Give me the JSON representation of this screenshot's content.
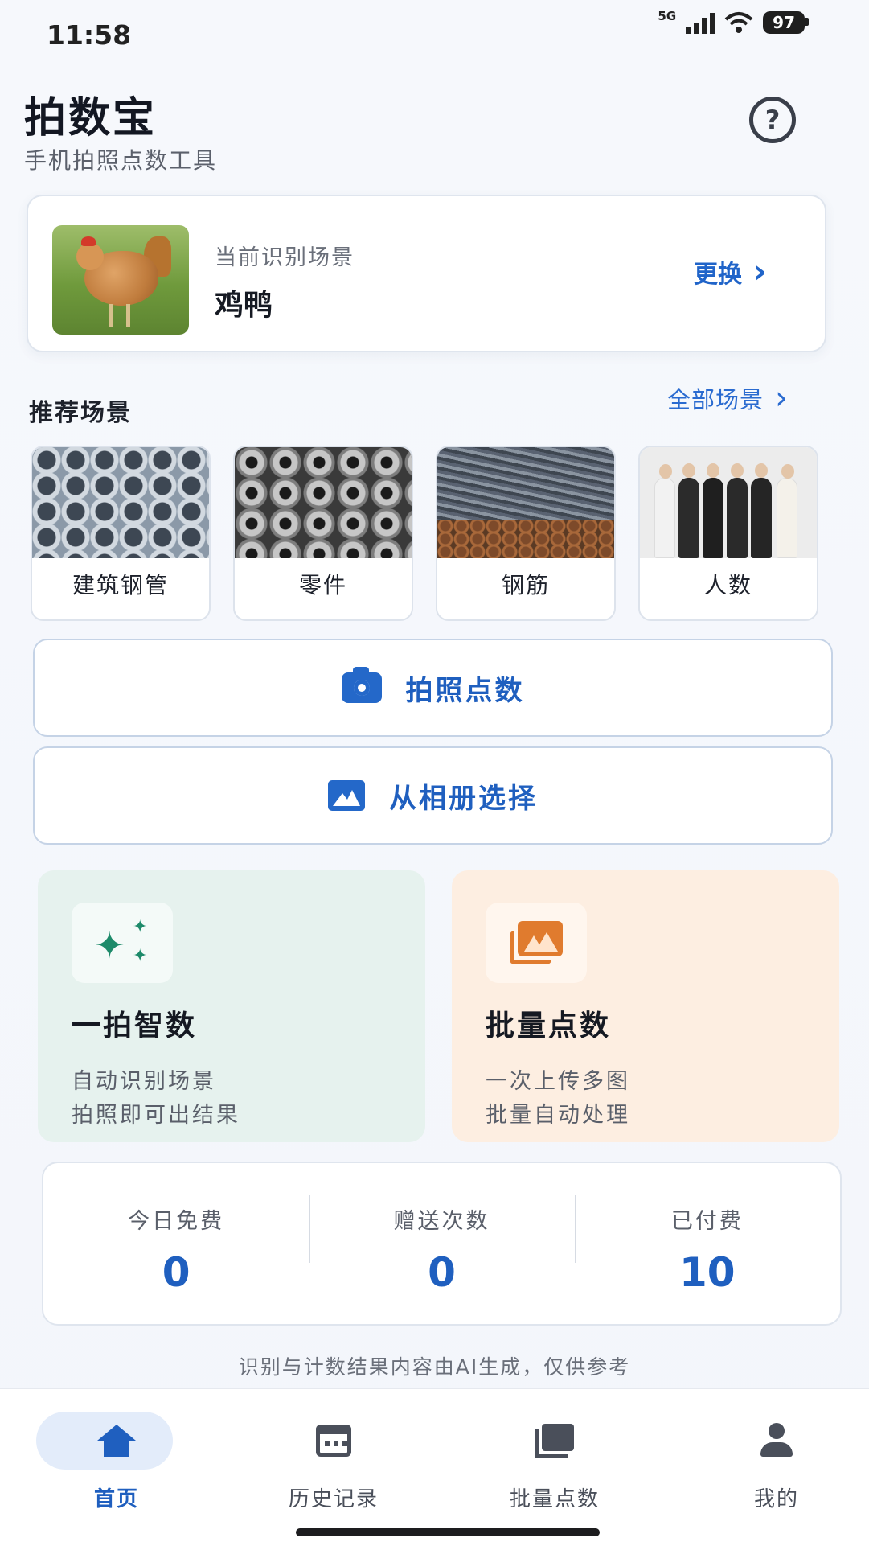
{
  "status_bar": {
    "time": "11:58",
    "network": "5G",
    "battery": "97"
  },
  "header": {
    "title": "拍数宝",
    "subtitle": "手机拍照点数工具",
    "help_icon": "question-circle-icon",
    "help_label": "?"
  },
  "current_scene": {
    "label": "当前识别场景",
    "value": "鸡鸭",
    "change_label": "更换",
    "change_arrow": "›"
  },
  "recommended": {
    "title": "推荐场景",
    "all_label": "全部场景",
    "all_arrow": "›",
    "items": [
      {
        "label": "建筑钢管"
      },
      {
        "label": "零件"
      },
      {
        "label": "钢筋"
      },
      {
        "label": "人数"
      }
    ]
  },
  "actions": {
    "camera_label": "拍照点数",
    "album_label": "从相册选择"
  },
  "features": {
    "smart": {
      "title": "一拍智数",
      "line1": "自动识别场景",
      "line2": "拍照即可出结果",
      "sparkles": [
        "✦",
        "✦",
        "✦"
      ]
    },
    "batch": {
      "title": "批量点数",
      "line1": "一次上传多图",
      "line2": "批量自动处理"
    }
  },
  "stats": [
    {
      "label": "今日免费",
      "value": "0"
    },
    {
      "label": "赠送次数",
      "value": "0"
    },
    {
      "label": "已付费",
      "value": "10"
    }
  ],
  "disclaimer": "识别与计数结果内容由AI生成，仅供参考",
  "tabs": [
    {
      "label": "首页",
      "icon": "home-icon",
      "active": true
    },
    {
      "label": "历史记录",
      "icon": "calendar-icon",
      "active": false
    },
    {
      "label": "批量点数",
      "icon": "gallery-icon",
      "active": false
    },
    {
      "label": "我的",
      "icon": "user-icon",
      "active": false
    }
  ],
  "colors": {
    "accent": "#1f5fbf",
    "smart_bg": "#e6f2ee",
    "batch_bg": "#fdeee1",
    "smart_icon": "#1d8a6a",
    "batch_icon": "#e07b2e"
  }
}
